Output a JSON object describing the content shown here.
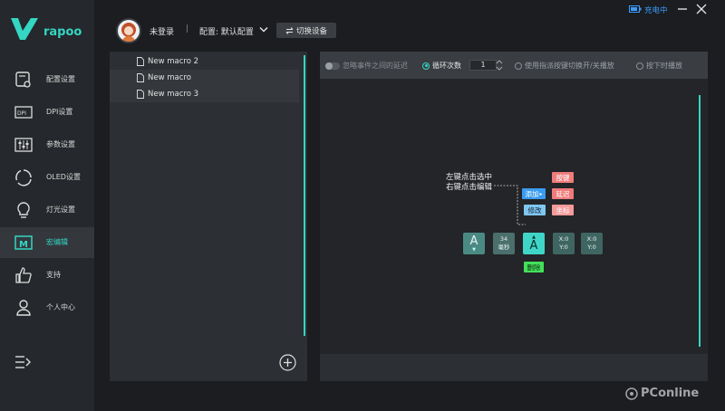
{
  "app": {
    "brand": "rapoo"
  },
  "window": {
    "charging_text": "充电中"
  },
  "header": {
    "user_name": "未登录",
    "separator": "|",
    "config_label": "配置: 默认配置",
    "switch_device_label": "切换设备"
  },
  "sidebar": {
    "items": [
      {
        "label": "配置设置",
        "icon": "config-icon"
      },
      {
        "label": "DPI设置",
        "icon": "dpi-icon"
      },
      {
        "label": "参数设置",
        "icon": "sliders-icon"
      },
      {
        "label": "OLED设置",
        "icon": "oled-icon"
      },
      {
        "label": "灯光设置",
        "icon": "lightbulb-icon"
      },
      {
        "label": "宏编辑",
        "icon": "macro-icon",
        "active": true
      },
      {
        "label": "支持",
        "icon": "thumbs-up-icon"
      },
      {
        "label": "个人中心",
        "icon": "user-icon"
      }
    ]
  },
  "macros": {
    "items": [
      {
        "label": "New macro 2"
      },
      {
        "label": "New macro"
      },
      {
        "label": "New macro 3"
      }
    ]
  },
  "editor": {
    "toolbar": {
      "ignore_delay_label": "忽略事件之间的延迟",
      "loop_label": "循环次数",
      "loop_value": "1",
      "toggle_key_label": "使用指派按键切换开/关播放",
      "hold_play_label": "按下时播放"
    },
    "hint_line1": "左键点击选中",
    "hint_line2": "右键点击编辑",
    "menu": {
      "add": "添加",
      "edit": "修改",
      "key": "按键",
      "delay": "延迟",
      "coord": "坐标",
      "delete": "删除"
    },
    "sequence": {
      "key_letter": "A",
      "delay_value": "34",
      "delay_unit": "毫秒",
      "selected_letter": "A",
      "coord1_x": "X:0",
      "coord1_y": "Y:0",
      "coord2_x": "X:0",
      "coord2_y": "Y:0"
    }
  },
  "watermark": "PConline",
  "colors": {
    "accent": "#34d6c4",
    "key_red": "#f07b7b",
    "add_blue": "#3a9cf0",
    "delete_green": "#44e05a"
  }
}
